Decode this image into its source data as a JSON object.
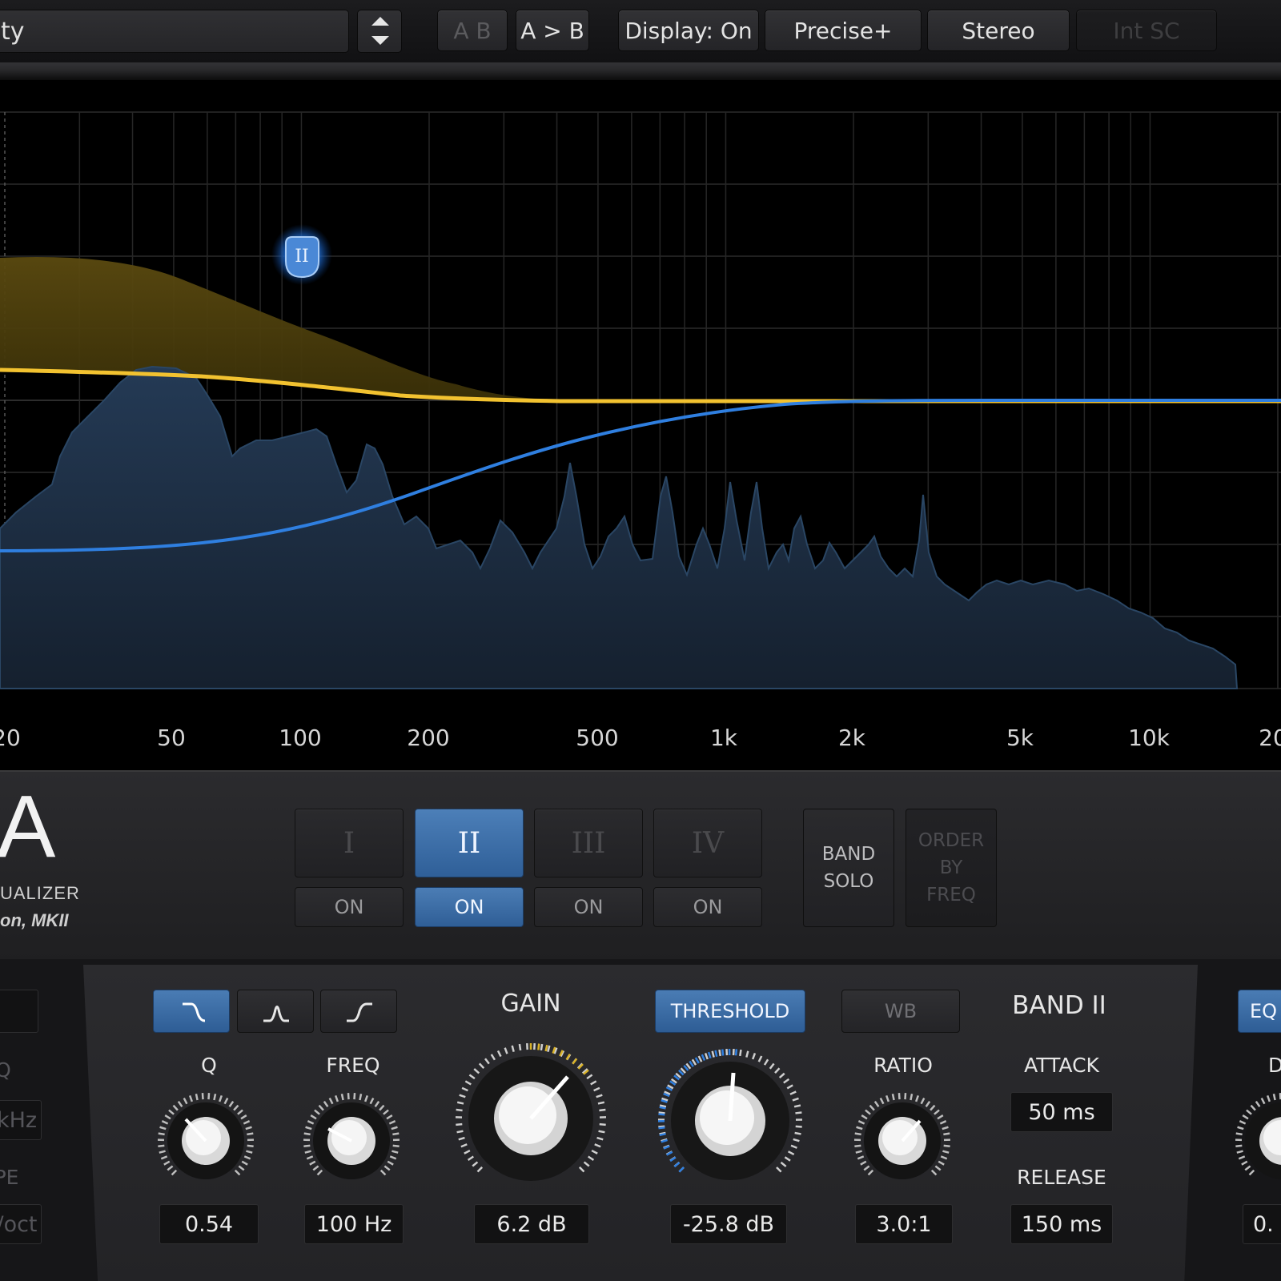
{
  "toolbar": {
    "preset_name": "ty",
    "ab_label": "A B",
    "a_to_b_label": "A > B",
    "display_label": "Display: On",
    "precise_label": "Precise+",
    "stereo_label": "Stereo",
    "int_sc_label": "Int SC"
  },
  "graph": {
    "freq_labels": [
      "20",
      "50",
      "100",
      "200",
      "500",
      "1k",
      "2k",
      "5k",
      "10k",
      "20"
    ],
    "node_label": "II",
    "colors": {
      "eq_curve": "#f2c230",
      "eq_fill": "#4a3a0c",
      "dyn_curve": "#2f7fe0",
      "spectrum": "#1b2a3c"
    }
  },
  "logo": {
    "letter": "A",
    "subtitle": "UALIZER",
    "version": "on, MKII"
  },
  "bands": [
    {
      "label": "I",
      "on_label": "ON",
      "active": false
    },
    {
      "label": "II",
      "on_label": "ON",
      "active": true
    },
    {
      "label": "III",
      "on_label": "ON",
      "active": false
    },
    {
      "label": "IV",
      "on_label": "ON",
      "active": false
    }
  ],
  "band_solo": {
    "line1": "BAND",
    "line2": "SOLO"
  },
  "order_by_freq": {
    "line1": "ORDER",
    "line2": "BY",
    "line3": "FREQ"
  },
  "left_partial": {
    "label1": "Q",
    "value1": "kHz",
    "label2": "PE",
    "value2": "/oct"
  },
  "controls": {
    "shapes": [
      "low-shelf",
      "peak",
      "high-shelf"
    ],
    "q": {
      "label": "Q",
      "value": "0.54"
    },
    "freq": {
      "label": "FREQ",
      "value": "100 Hz"
    },
    "gain": {
      "label": "GAIN",
      "value": "6.2 dB"
    },
    "threshold": {
      "label": "THRESHOLD",
      "value": "-25.8 dB"
    },
    "wb": {
      "label": "WB"
    },
    "ratio": {
      "label": "RATIO",
      "value": "3.0:1"
    },
    "band_title": "BAND II",
    "attack": {
      "label": "ATTACK",
      "value": "50 ms"
    },
    "release": {
      "label": "RELEASE",
      "value": "150 ms"
    },
    "eq_button": "EQ",
    "dry": {
      "label": "DRY",
      "value": "0."
    }
  }
}
